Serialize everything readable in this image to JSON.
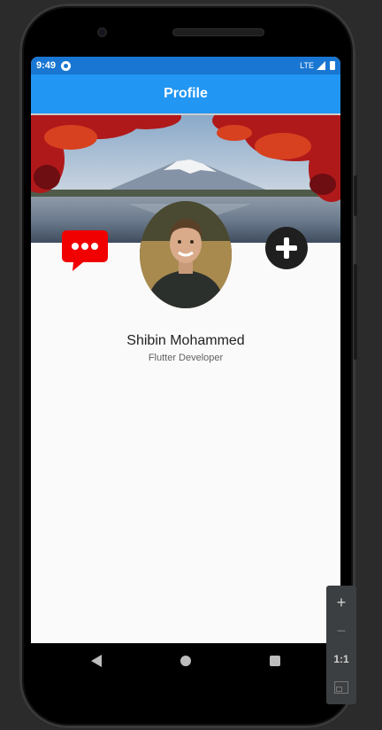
{
  "status_bar": {
    "time": "9:49",
    "network": "LTE"
  },
  "app_bar": {
    "title": "Profile"
  },
  "profile": {
    "name": "Shibin Mohammed",
    "role": "Flutter Developer"
  },
  "zoom_controls": {
    "zoom_in": "+",
    "zoom_out": "−",
    "actual_size": "1:1"
  },
  "icons": {
    "chat": "chat-bubble-icon",
    "add": "add-circle-icon"
  },
  "colors": {
    "status_bar": "#1976d2",
    "app_bar": "#2196f3",
    "chat_icon": "#f00000",
    "add_button": "#1f1f1f"
  }
}
